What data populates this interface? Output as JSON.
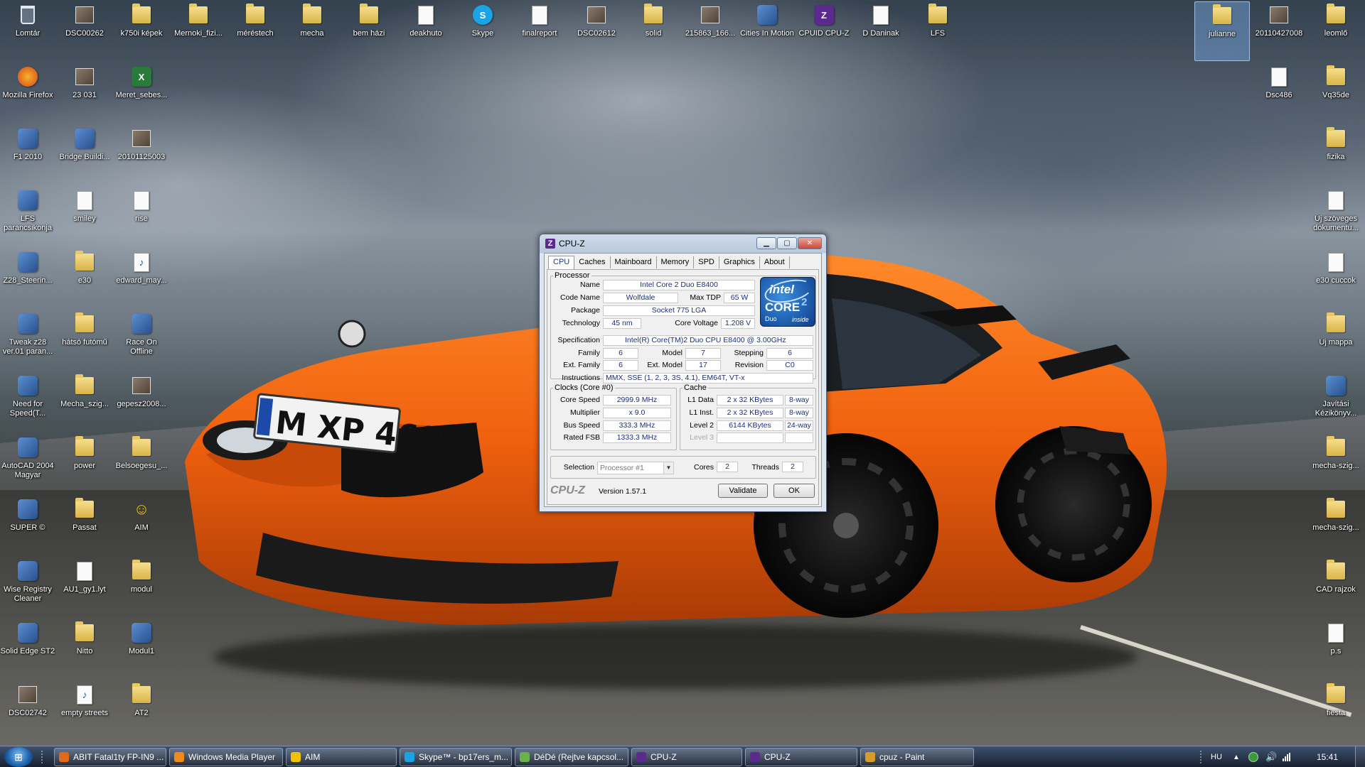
{
  "desktop": {
    "icons": [
      {
        "label": "Lomtár",
        "type": "trash"
      },
      {
        "label": "DSC00262",
        "type": "photo"
      },
      {
        "label": "k750i képek",
        "type": "folder"
      },
      {
        "label": "Mernoki_fizi...",
        "type": "folder"
      },
      {
        "label": "méréstech",
        "type": "folder"
      },
      {
        "label": "mecha",
        "type": "folder"
      },
      {
        "label": "bem házi",
        "type": "folder"
      },
      {
        "label": "deakhuto",
        "type": "doc"
      },
      {
        "label": "Skype",
        "type": "skype"
      },
      {
        "label": "finalreport",
        "type": "doc"
      },
      {
        "label": "DSC02612",
        "type": "photo"
      },
      {
        "label": "solid",
        "type": "folder"
      },
      {
        "label": "215863_166...",
        "type": "photo"
      },
      {
        "label": "Cities In Motion",
        "type": "app"
      },
      {
        "label": "CPUID CPU-Z",
        "type": "cpuz"
      },
      {
        "label": "D Daninak",
        "type": "doc"
      },
      {
        "label": "LFS",
        "type": "folder"
      },
      {
        "label": "julianne",
        "type": "folder"
      },
      {
        "label": "20110427008",
        "type": "photo"
      },
      {
        "label": "leomlő",
        "type": "folder"
      },
      {
        "label": "Mozilla Firefox",
        "type": "firefox"
      },
      {
        "label": "23 031",
        "type": "photo"
      },
      {
        "label": "Meret_sebes...",
        "type": "excel"
      },
      {
        "label": "Dsc486",
        "type": "doc"
      },
      {
        "label": "Vq35de",
        "type": "folder"
      },
      {
        "label": "F1 2010",
        "type": "app"
      },
      {
        "label": "Bridge Buildi...",
        "type": "app"
      },
      {
        "label": "20101125003",
        "type": "photo"
      },
      {
        "label": "fizika",
        "type": "folder"
      },
      {
        "label": "LFS parancsikonja",
        "type": "app"
      },
      {
        "label": "smiley",
        "type": "doc"
      },
      {
        "label": "rise",
        "type": "doc"
      },
      {
        "label": "Új szöveges dokumentu...",
        "type": "doc"
      },
      {
        "label": "Z28_Steerin...",
        "type": "app"
      },
      {
        "label": "e30",
        "type": "folder"
      },
      {
        "label": "edward_may...",
        "type": "music"
      },
      {
        "label": "e30 cuccok",
        "type": "doc"
      },
      {
        "label": "Tweak z28 ver.01 paran...",
        "type": "app"
      },
      {
        "label": "hátsó futómű",
        "type": "folder"
      },
      {
        "label": "Race On Offline",
        "type": "app"
      },
      {
        "label": "Új mappa",
        "type": "folder"
      },
      {
        "label": "Need for Speed(T...",
        "type": "app"
      },
      {
        "label": "Mecha_szig...",
        "type": "folder"
      },
      {
        "label": "gepesz2008...",
        "type": "photo"
      },
      {
        "label": "Javítási Kézikönyv...",
        "type": "app"
      },
      {
        "label": "AutoCAD 2004 Magyar",
        "type": "app"
      },
      {
        "label": "power",
        "type": "folder"
      },
      {
        "label": "Belsoegesu_...",
        "type": "folder"
      },
      {
        "label": "mecha-szig...",
        "type": "folder"
      },
      {
        "label": "SUPER ©",
        "type": "app"
      },
      {
        "label": "Passat",
        "type": "folder"
      },
      {
        "label": "AIM",
        "type": "aim"
      },
      {
        "label": "mecha-szig...",
        "type": "folder"
      },
      {
        "label": "Wise Registry Cleaner",
        "type": "app"
      },
      {
        "label": "AU1_gy1.lyt",
        "type": "doc"
      },
      {
        "label": "modul",
        "type": "folder"
      },
      {
        "label": "CAD rajzok",
        "type": "folder"
      },
      {
        "label": "Solid Edge ST2",
        "type": "app"
      },
      {
        "label": "Nitto",
        "type": "folder"
      },
      {
        "label": "Modul1",
        "type": "app"
      },
      {
        "label": "p.s",
        "type": "doc"
      },
      {
        "label": "DSC02742",
        "type": "photo"
      },
      {
        "label": "empty streets",
        "type": "music"
      },
      {
        "label": "AT2",
        "type": "folder"
      },
      {
        "label": "fiesta",
        "type": "folder"
      }
    ],
    "plate": "M XP 4699"
  },
  "cpuz": {
    "title": "CPU-Z",
    "tabs": [
      "CPU",
      "Caches",
      "Mainboard",
      "Memory",
      "SPD",
      "Graphics",
      "About"
    ],
    "processor": {
      "legend": "Processor",
      "name_label": "Name",
      "name": "Intel Core 2 Duo E8400",
      "codename_label": "Code Name",
      "codename": "Wolfdale",
      "maxtdp_label": "Max TDP",
      "maxtdp": "65 W",
      "package_label": "Package",
      "package": "Socket 775 LGA",
      "technology_label": "Technology",
      "technology": "45 nm",
      "corevoltage_label": "Core Voltage",
      "corevoltage": "1.208 V",
      "spec_label": "Specification",
      "spec": "Intel(R) Core(TM)2 Duo CPU     E8400  @ 3.00GHz",
      "family_label": "Family",
      "family": "6",
      "model_label": "Model",
      "model": "7",
      "stepping_label": "Stepping",
      "stepping": "6",
      "extfamily_label": "Ext. Family",
      "extfamily": "6",
      "extmodel_label": "Ext. Model",
      "extmodel": "17",
      "revision_label": "Revision",
      "revision": "C0",
      "instructions_label": "Instructions",
      "instructions": "MMX, SSE (1, 2, 3, 3S, 4.1), EM64T, VT-x"
    },
    "logo": {
      "brand": "intel",
      "line": "CORE",
      "num": "2",
      "sub": "Duo",
      "inside": "inside"
    },
    "clocks": {
      "legend": "Clocks (Core #0)",
      "corespeed_label": "Core Speed",
      "corespeed": "2999.9 MHz",
      "multiplier_label": "Multiplier",
      "multiplier": "x 9.0",
      "busspeed_label": "Bus Speed",
      "busspeed": "333.3 MHz",
      "ratedfsb_label": "Rated FSB",
      "ratedfsb": "1333.3 MHz"
    },
    "cache": {
      "legend": "Cache",
      "l1d_label": "L1 Data",
      "l1d": "2 x 32 KBytes",
      "l1d_way": "8-way",
      "l1i_label": "L1 Inst.",
      "l1i": "2 x 32 KBytes",
      "l1i_way": "8-way",
      "l2_label": "Level 2",
      "l2": "6144 KBytes",
      "l2_way": "24-way",
      "l3_label": "Level 3"
    },
    "selection_label": "Selection",
    "selection": "Processor #1",
    "cores_label": "Cores",
    "cores": "2",
    "threads_label": "Threads",
    "threads": "2",
    "brand_footer": "CPU-Z",
    "version": "Version 1.57.1",
    "validate": "Validate",
    "ok": "OK"
  },
  "taskbar": {
    "items": [
      {
        "label": "ABIT Fatal1ty FP-IN9 ...",
        "color": "#e06a1a"
      },
      {
        "label": "Windows Media Player",
        "color": "#f08a1a"
      },
      {
        "label": "AIM",
        "color": "#f2c200"
      },
      {
        "label": "Skype™ - bp17ers_m...",
        "color": "#1aa3e6"
      },
      {
        "label": "DéDé (Rejtve kapcsol...",
        "color": "#6ab04c"
      },
      {
        "label": "CPU-Z",
        "color": "#5a2a8e"
      },
      {
        "label": "CPU-Z",
        "color": "#5a2a8e"
      },
      {
        "label": "cpuz - Paint",
        "color": "#d89a2a"
      }
    ],
    "lang": "HU",
    "clock": "15:41"
  }
}
